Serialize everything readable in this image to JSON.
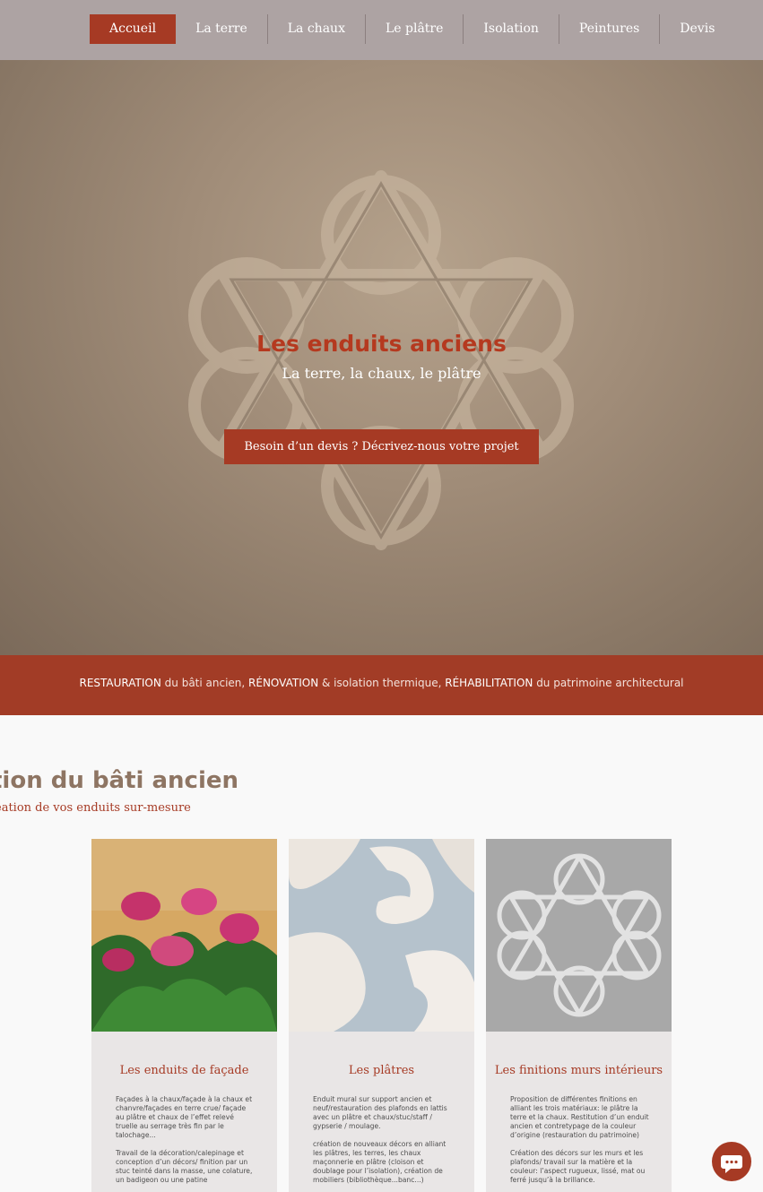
{
  "nav": {
    "items": [
      "Accueil",
      "La terre",
      "La chaux",
      "Le plâtre",
      "Isolation",
      "Peintures",
      "Devis"
    ],
    "active": "Accueil"
  },
  "hero": {
    "title": "Les enduits anciens",
    "subtitle": "La terre, la chaux, le plâtre",
    "cta": "Besoin d’un devis ? Décrivez-nous votre projet"
  },
  "band": {
    "w1": "RESTAURATION",
    "t1": " du bâti ancien, ",
    "w2": "RÉNOVATION",
    "t2": " & isolation thermique, ",
    "w3": "RÉHABILITATION",
    "t3": " du patrimoine architectural"
  },
  "section": {
    "title": "tion du bâti ancien",
    "subtitle": "éation de vos enduits sur-mesure"
  },
  "cards": [
    {
      "title": "Les enduits de façade",
      "p1": "Façades à la chaux/façade à la chaux et chanvre/façades en terre crue/ façade au plâtre et chaux de l’effet relevé truelle au serrage très fin par le talochage...",
      "p2": "Travail de la décoration/calepinage et conception d’un décors/ finition par un stuc teinté dans la masse, une colature, un badigeon ou une patine"
    },
    {
      "title": "Les plâtres",
      "p1": "Enduit mural sur support ancien et neuf/restauration des plafonds en lattis avec un plâtre et chaux/stuc/staff / gypserie / moulage.",
      "p2": "création de nouveaux décors en alliant les plâtres, les terres, les chaux maçonnerie en plâtre (cloison et doublage pour l’isolation), création de mobiliers (bibliothèque...banc...)"
    },
    {
      "title": "Les finitions murs intérieurs",
      "p1": "Proposition de différentes finitions en alliant les trois matériaux: le plâtre la terre et la chaux. Restitution d’un enduit ancien et contretypage de la couleur d’origine (restauration du patrimoine)",
      "p2": "Création des décors sur les murs et les plafonds/ travail sur la matière et la couleur: l’aspect rugueux, lissé, mat ou ferré jusqu’à la brillance."
    }
  ],
  "colors": {
    "accent": "#a63a24",
    "nav_bg": "#ada3a3",
    "band": "#a23c26"
  },
  "icons": {
    "chat": "chat-bubble-icon"
  }
}
